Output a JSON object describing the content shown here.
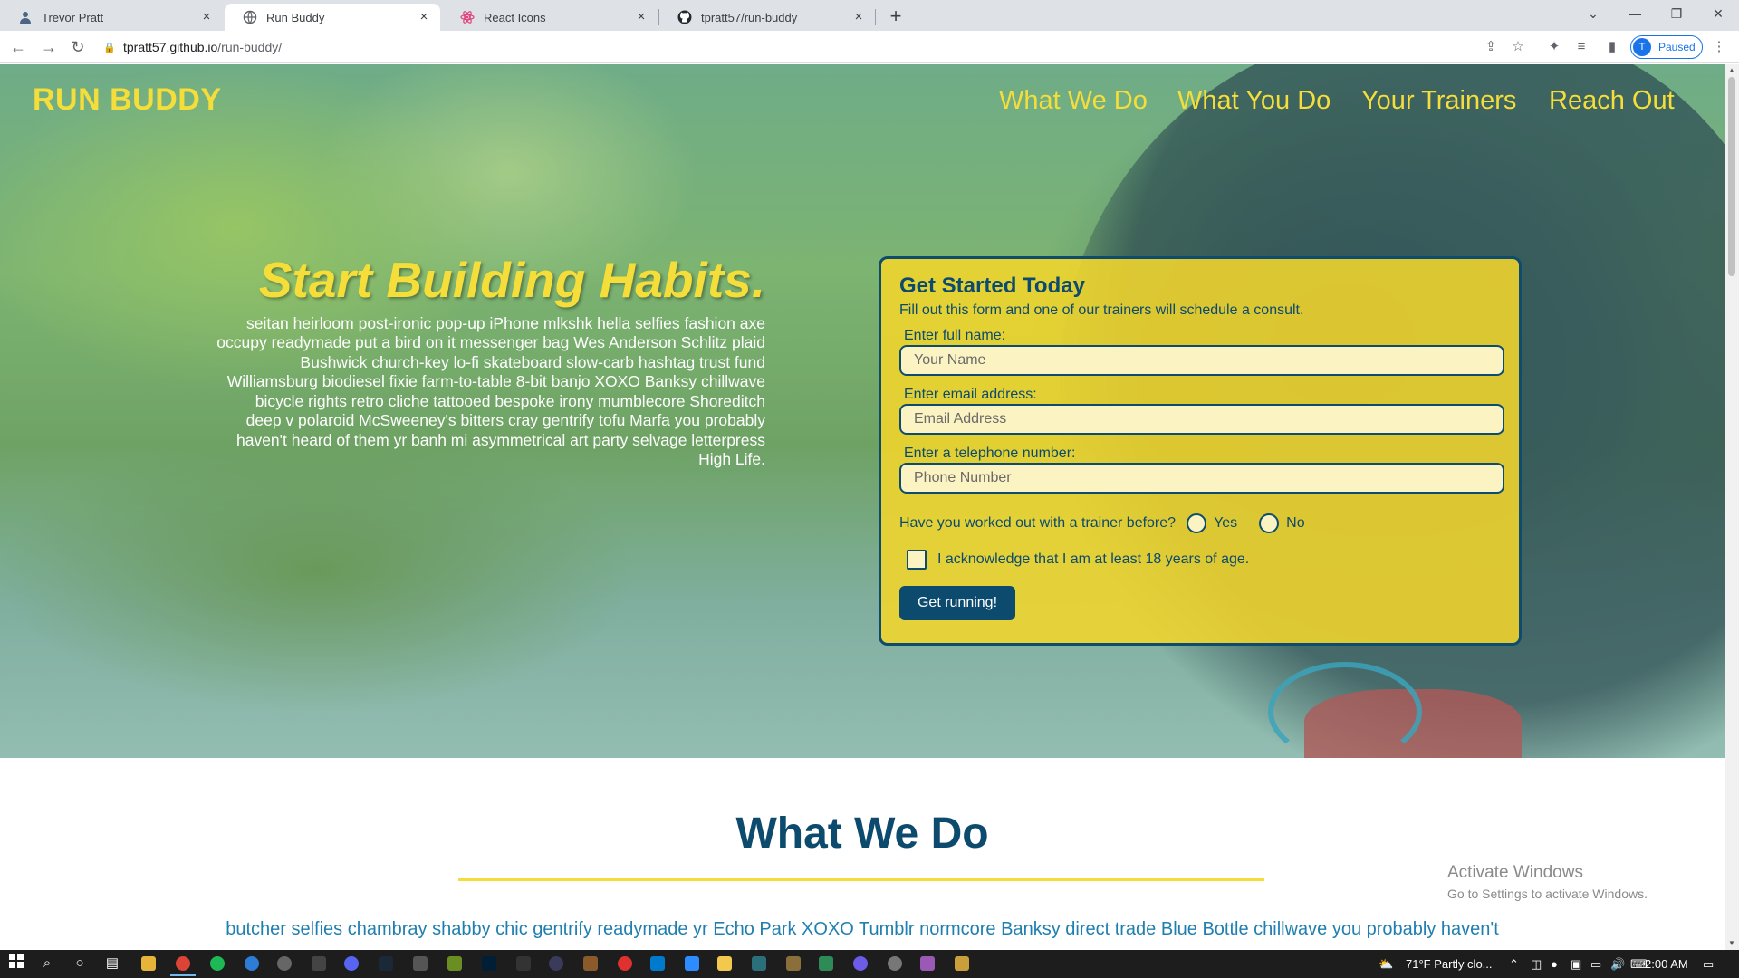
{
  "browser": {
    "tabs": [
      {
        "label": "Trevor Pratt",
        "icon": "person-icon"
      },
      {
        "label": "Run Buddy",
        "icon": "globe-icon"
      },
      {
        "label": "React Icons",
        "icon": "react-icon"
      },
      {
        "label": "tpratt57/run-buddy",
        "icon": "github-icon"
      }
    ],
    "active_tab": 1,
    "url_host": "tpratt57.github.io",
    "url_path": "/run-buddy/",
    "profile_initial": "T",
    "profile_status": "Paused"
  },
  "page": {
    "brand": "RUN BUDDY",
    "nav": [
      "What We Do",
      "What You Do",
      "Your Trainers",
      "Reach Out"
    ],
    "hero_title": "Start Building Habits.",
    "hero_lines": [
      "seitan heirloom post-ironic pop-up iPhone mlkshk hella selfies fashion axe",
      "occupy readymade put a bird on it messenger bag Wes Anderson Schlitz plaid",
      "Bushwick church-key lo-fi skateboard slow-carb hashtag trust fund",
      "Williamsburg biodiesel fixie farm-to-table 8-bit banjo XOXO Banksy chillwave",
      "bicycle rights retro cliche tattooed bespoke irony mumblecore Shoreditch",
      "deep v polaroid McSweeney's bitters cray gentrify tofu Marfa you probably",
      "haven't heard of them yr banh mi asymmetrical art party selvage letterpress",
      "High Life."
    ],
    "form": {
      "title": "Get Started Today",
      "subtitle": "Fill out this form and one of our trainers will schedule a consult.",
      "name_label": "Enter full name:",
      "name_placeholder": "Your Name",
      "email_label": "Enter email address:",
      "email_placeholder": "Email Address",
      "phone_label": "Enter a telephone number:",
      "phone_placeholder": "Phone Number",
      "trainer_question": "Have you worked out with a trainer before?",
      "yes": "Yes",
      "no": "No",
      "age_ack": "I acknowledge that I am at least 18 years of age.",
      "submit": "Get running!"
    },
    "section_title": "What We Do",
    "section_text": "butcher selfies chambray shabby chic gentrify readymade yr Echo Park XOXO Tumblr normcore Banksy direct trade Blue Bottle chillwave you probably haven't",
    "watermark_title": "Activate Windows",
    "watermark_sub": "Go to Settings to activate Windows."
  },
  "taskbar": {
    "weather": "71°F  Partly clo...",
    "time": "2:00 AM"
  },
  "colors": {
    "brand_yellow": "#f5dd3a",
    "navy": "#0c4a6e",
    "link_blue": "#1f7fb0"
  }
}
